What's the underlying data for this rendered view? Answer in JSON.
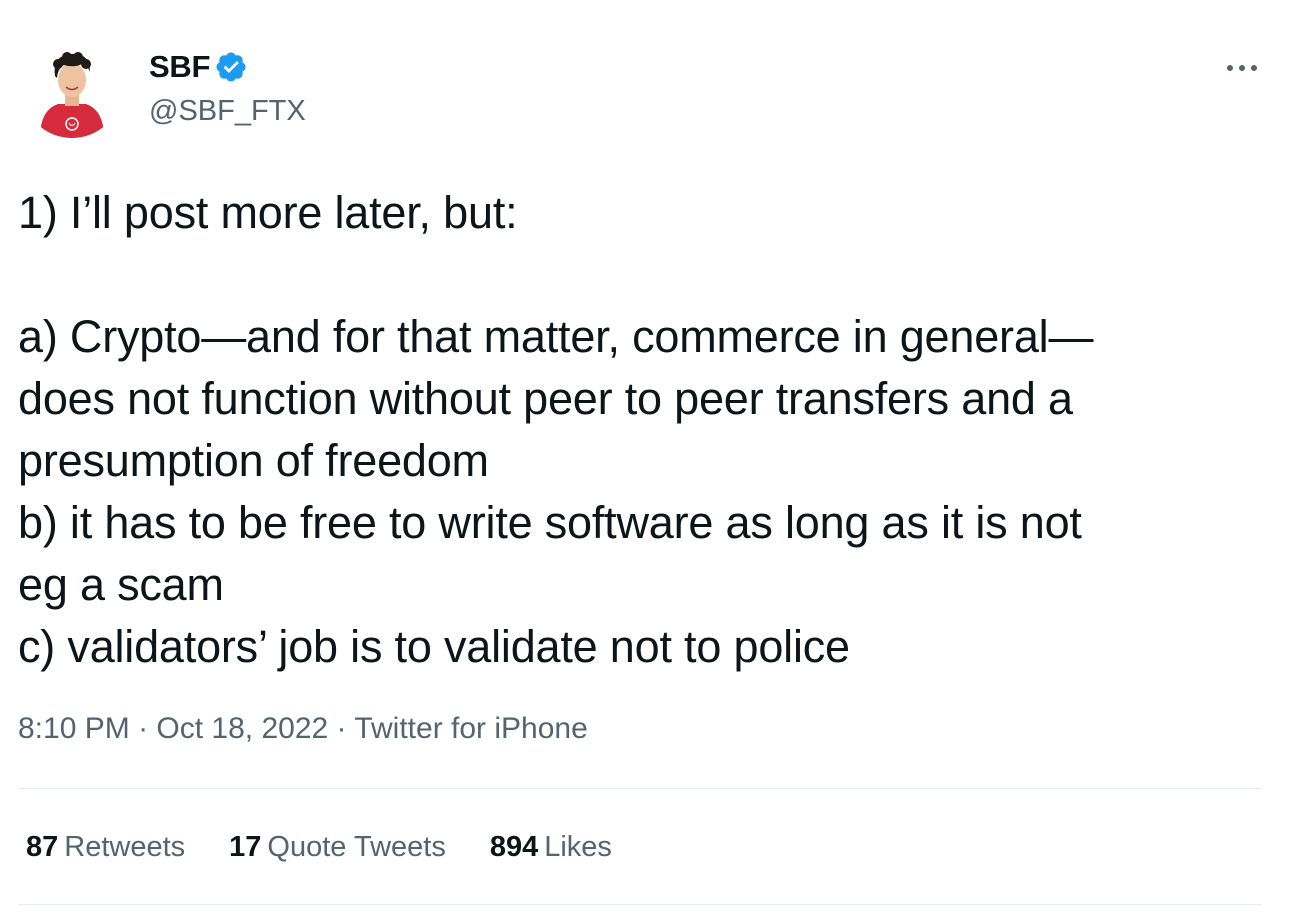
{
  "user": {
    "display_name": "SBF",
    "handle": "@SBF_FTX",
    "verified_icon": "verified-badge-icon",
    "avatar_icon": "profile-avatar"
  },
  "menu": {
    "more_icon": "more-options-icon"
  },
  "tweet": {
    "lines": [
      "1) I’ll post more later, but:",
      "",
      "a) Crypto—and for that matter, commerce in general—",
      "does not function without peer to peer transfers and a",
      "presumption of freedom",
      "b) it has to be free to write software as long as it is not",
      "eg a scam",
      "c) validators’ job is to validate not to police"
    ]
  },
  "meta": {
    "time": "8:10 PM",
    "separator": "·",
    "date": "Oct 18, 2022",
    "source": "Twitter for iPhone"
  },
  "stats": {
    "retweets": {
      "count": "87",
      "label": "Retweets"
    },
    "quote_tweets": {
      "count": "17",
      "label": "Quote Tweets"
    },
    "likes": {
      "count": "894",
      "label": "Likes"
    }
  },
  "colors": {
    "text": "#0f1419",
    "secondary": "#536471",
    "verified_blue": "#1d9bf0",
    "divider": "#e6ecf0"
  }
}
